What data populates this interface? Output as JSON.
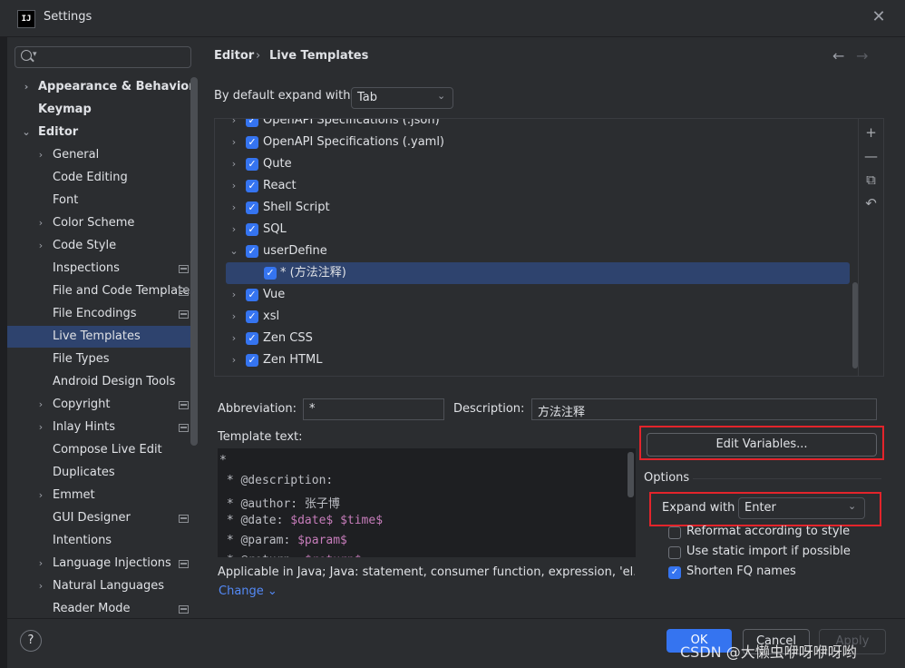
{
  "window": {
    "title": "Settings",
    "logo": "IJ",
    "close_glyph": "✕"
  },
  "search": {
    "icon": "search-icon",
    "caret": "▾"
  },
  "sidebar": {
    "items": [
      {
        "label": "Appearance & Behavior",
        "bold": true,
        "chevron": "›"
      },
      {
        "label": "Keymap",
        "bold": true,
        "chevron": ""
      },
      {
        "label": "Editor",
        "bold": true,
        "chevron": "⌄"
      },
      {
        "label": "General",
        "chevron": "›"
      },
      {
        "label": "Code Editing",
        "chevron": ""
      },
      {
        "label": "Font",
        "chevron": ""
      },
      {
        "label": "Color Scheme",
        "chevron": "›"
      },
      {
        "label": "Code Style",
        "chevron": "›"
      },
      {
        "label": "Inspections",
        "chevron": "",
        "project": true
      },
      {
        "label": "File and Code Templates",
        "chevron": "",
        "project": true
      },
      {
        "label": "File Encodings",
        "chevron": "",
        "project": true
      },
      {
        "label": "Live Templates",
        "chevron": "",
        "selected": true
      },
      {
        "label": "File Types",
        "chevron": ""
      },
      {
        "label": "Android Design Tools",
        "chevron": ""
      },
      {
        "label": "Copyright",
        "chevron": "›",
        "project": true
      },
      {
        "label": "Inlay Hints",
        "chevron": "›",
        "project": true
      },
      {
        "label": "Compose Live Edit",
        "chevron": ""
      },
      {
        "label": "Duplicates",
        "chevron": ""
      },
      {
        "label": "Emmet",
        "chevron": "›"
      },
      {
        "label": "GUI Designer",
        "chevron": "",
        "project": true
      },
      {
        "label": "Intentions",
        "chevron": ""
      },
      {
        "label": "Language Injections",
        "chevron": "›",
        "project": true
      },
      {
        "label": "Natural Languages",
        "chevron": "›"
      },
      {
        "label": "Reader Mode",
        "chevron": "",
        "project": true
      }
    ]
  },
  "breadcrumb": {
    "editor": "Editor",
    "sep": "›",
    "live_templates": "Live Templates"
  },
  "nav": {
    "back": "←",
    "forward": "→"
  },
  "expand_default": {
    "label": "By default expand with",
    "value": "Tab",
    "arrow": "⌄"
  },
  "template_groups": [
    {
      "label": "OpenAPI Specifications (.json)",
      "chevron": "›",
      "checked": true
    },
    {
      "label": "OpenAPI Specifications (.yaml)",
      "chevron": "›",
      "checked": true
    },
    {
      "label": "Qute",
      "chevron": "›",
      "checked": true
    },
    {
      "label": "React",
      "chevron": "›",
      "checked": true
    },
    {
      "label": "Shell Script",
      "chevron": "›",
      "checked": true
    },
    {
      "label": "SQL",
      "chevron": "›",
      "checked": true
    },
    {
      "label": "userDefine",
      "chevron": "⌄",
      "checked": true
    },
    {
      "label": "* (方法注释)",
      "chevron": "",
      "checked": true,
      "child": true,
      "selected": true
    },
    {
      "label": "Vue",
      "chevron": "›",
      "checked": true
    },
    {
      "label": "xsl",
      "chevron": "›",
      "checked": true
    },
    {
      "label": "Zen CSS",
      "chevron": "›",
      "checked": true
    },
    {
      "label": "Zen HTML",
      "chevron": "›",
      "checked": true
    }
  ],
  "list_toolbar": {
    "add": "+",
    "remove": "—",
    "copy": "⧉",
    "restore": "↶"
  },
  "checkmark": "✓",
  "abbreviation": {
    "label": "Abbreviation:",
    "value": "*"
  },
  "description": {
    "label": "Description:",
    "value": "方法注释"
  },
  "template_text": {
    "label": "Template text:",
    "lines": [
      [
        {
          "t": "*"
        }
      ],
      [
        {
          "t": " * @description:"
        }
      ],
      [
        {
          "t": " * @author: 张子博"
        }
      ],
      [
        {
          "t": " * @date: "
        },
        {
          "t": "$date$",
          "var": true
        },
        {
          "t": " "
        },
        {
          "t": "$time$",
          "var": true
        }
      ],
      [
        {
          "t": " * @param: "
        },
        {
          "t": "$param$",
          "var": true
        }
      ],
      [
        {
          "t": " * @return: "
        },
        {
          "t": "$return$",
          "var": true
        }
      ]
    ]
  },
  "applicable": {
    "text": "Applicable in Java; Java: statement, consumer function, expression, 'el...",
    "change": "Change ⌄"
  },
  "edit_variables": {
    "label": "Edit Variables..."
  },
  "options": {
    "label": "Options",
    "expand_with": {
      "label": "Expand with",
      "value": "Enter",
      "arrow": "⌄"
    },
    "reformat": {
      "label": "Reformat according to style",
      "checked": false
    },
    "static_import": {
      "label": "Use static import if possible",
      "checked": false
    },
    "shorten_fq": {
      "label": "Shorten FQ names",
      "checked": true
    }
  },
  "footer": {
    "help": "?",
    "ok": "OK",
    "cancel": "Cancel",
    "apply": "Apply"
  },
  "watermark": "CSDN @大懒虫咿呀咿呀哟"
}
